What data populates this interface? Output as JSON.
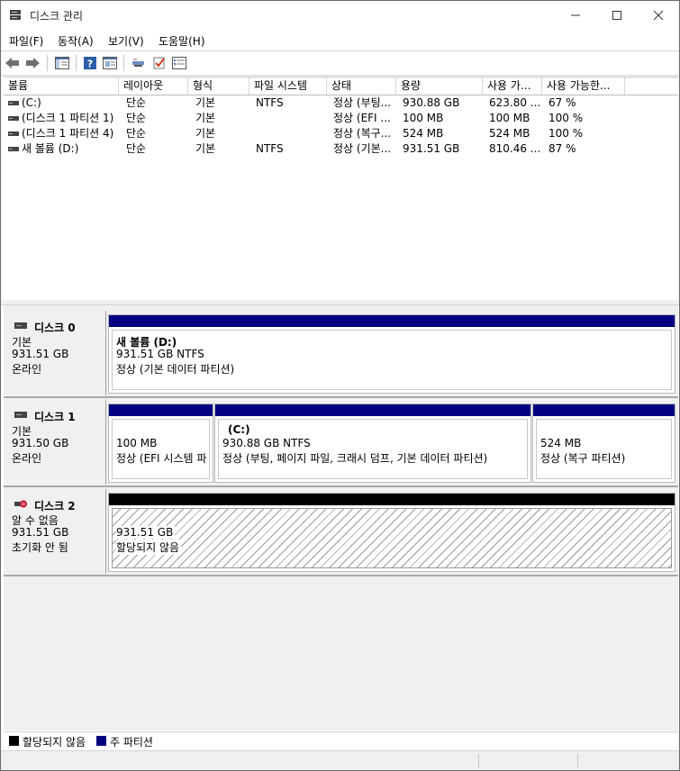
{
  "window": {
    "title": "디스크 관리"
  },
  "menu": [
    "파일(F)",
    "동작(A)",
    "보기(V)",
    "도움말(H)"
  ],
  "toolbar": {
    "buttons": [
      "back-icon",
      "forward-icon",
      "show-hide-console-tree-icon",
      "help-icon",
      "properties-icon",
      "connect-icon",
      "checkmark-icon",
      "list-icon"
    ]
  },
  "volume_list": {
    "columns": [
      "볼륨",
      "레이아웃",
      "형식",
      "파일 시스템",
      "상태",
      "용량",
      "사용 가...",
      "사용 가능한..."
    ],
    "rows": [
      [
        "(C:)",
        "단순",
        "기본",
        "NTFS",
        "정상 (부팅...",
        "930.88 GB",
        "623.80 ...",
        "67 %"
      ],
      [
        "(디스크 1 파티션 1)",
        "단순",
        "기본",
        "",
        "정상 (EFI ...",
        "100 MB",
        "100 MB",
        "100 %"
      ],
      [
        "(디스크 1 파티션 4)",
        "단순",
        "기본",
        "",
        "정상 (복구...",
        "524 MB",
        "524 MB",
        "100 %"
      ],
      [
        "새 볼륨 (D:)",
        "단순",
        "기본",
        "NTFS",
        "정상 (기본...",
        "931.51 GB",
        "810.46 ...",
        "87 %"
      ]
    ]
  },
  "disks": [
    {
      "name": "디스크 0",
      "type": "기본",
      "size": "931.51 GB",
      "status": "온라인",
      "partitions": [
        {
          "title": "새 볼륨  (D:)",
          "line1": "931.51 GB NTFS",
          "line2": "정상 (기본 데이터 파티션)"
        }
      ]
    },
    {
      "name": "디스크 1",
      "type": "기본",
      "size": "931.50 GB",
      "status": "온라인",
      "partitions": [
        {
          "title": "",
          "line1": "100 MB",
          "line2": "정상 (EFI 시스템 파"
        },
        {
          "title": "(C:)",
          "line1": "930.88 GB NTFS",
          "line2": "정상 (부팅, 페이지 파일, 크래시 덤프, 기본 데이터 파티션)"
        },
        {
          "title": "",
          "line1": "524 MB",
          "line2": "정상 (복구 파티션)"
        }
      ]
    },
    {
      "name": "디스크 2",
      "type": "알 수 없음",
      "size": "931.51 GB",
      "status": "초기화 안 됨",
      "partitions": [
        {
          "title": "",
          "line1": "931.51 GB",
          "line2": "할당되지 않음"
        }
      ]
    }
  ],
  "legend": [
    {
      "label": "할당되지 않음",
      "color": "#000000"
    },
    {
      "label": "주 파티션",
      "color": "#020080"
    }
  ]
}
